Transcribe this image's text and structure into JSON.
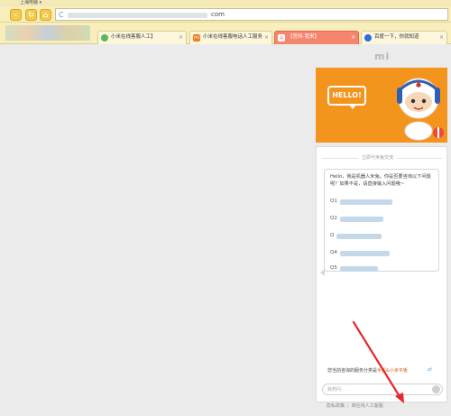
{
  "browser": {
    "title": "上海电脑 ▾",
    "address": {
      "visible_suffix": "com"
    },
    "nav_buttons": [
      "back",
      "forward",
      "home"
    ],
    "tabs": [
      {
        "label": "小米在线客服人工】",
        "icon": "mi-tab-icon",
        "active": false
      },
      {
        "label": "小米在线客服电话人工服务",
        "icon": "mi-tab-icon",
        "active": false
      },
      {
        "label": "【官网-我来】",
        "icon": "doc-tab-icon",
        "active": true
      },
      {
        "label": "百度一下，你就知道",
        "icon": "baidu-tab-icon",
        "active": false
      }
    ],
    "close_glyph": "×"
  },
  "page": {
    "logo": "mi",
    "banner": {
      "hello_text": "HELLO!",
      "bg_color": "#f3941d"
    },
    "chat": {
      "divider_label": "立即与米兔交流",
      "greeting": "Hello，我是机器人米兔。你是否要咨询以下问题呢？如果不是，请直接输入问题哦~",
      "questions": [
        "Q1",
        "Q2",
        "Q",
        "Q4",
        "Q5"
      ],
      "bottom_tip_prefix": "您当前咨询的服务分类是",
      "bottom_tip_link": "手机&小米平板",
      "input_placeholder": "我想问…",
      "footer_left": "隐私政策",
      "footer_right": "转在线人工客服"
    },
    "accent_color": "#f4856f"
  }
}
